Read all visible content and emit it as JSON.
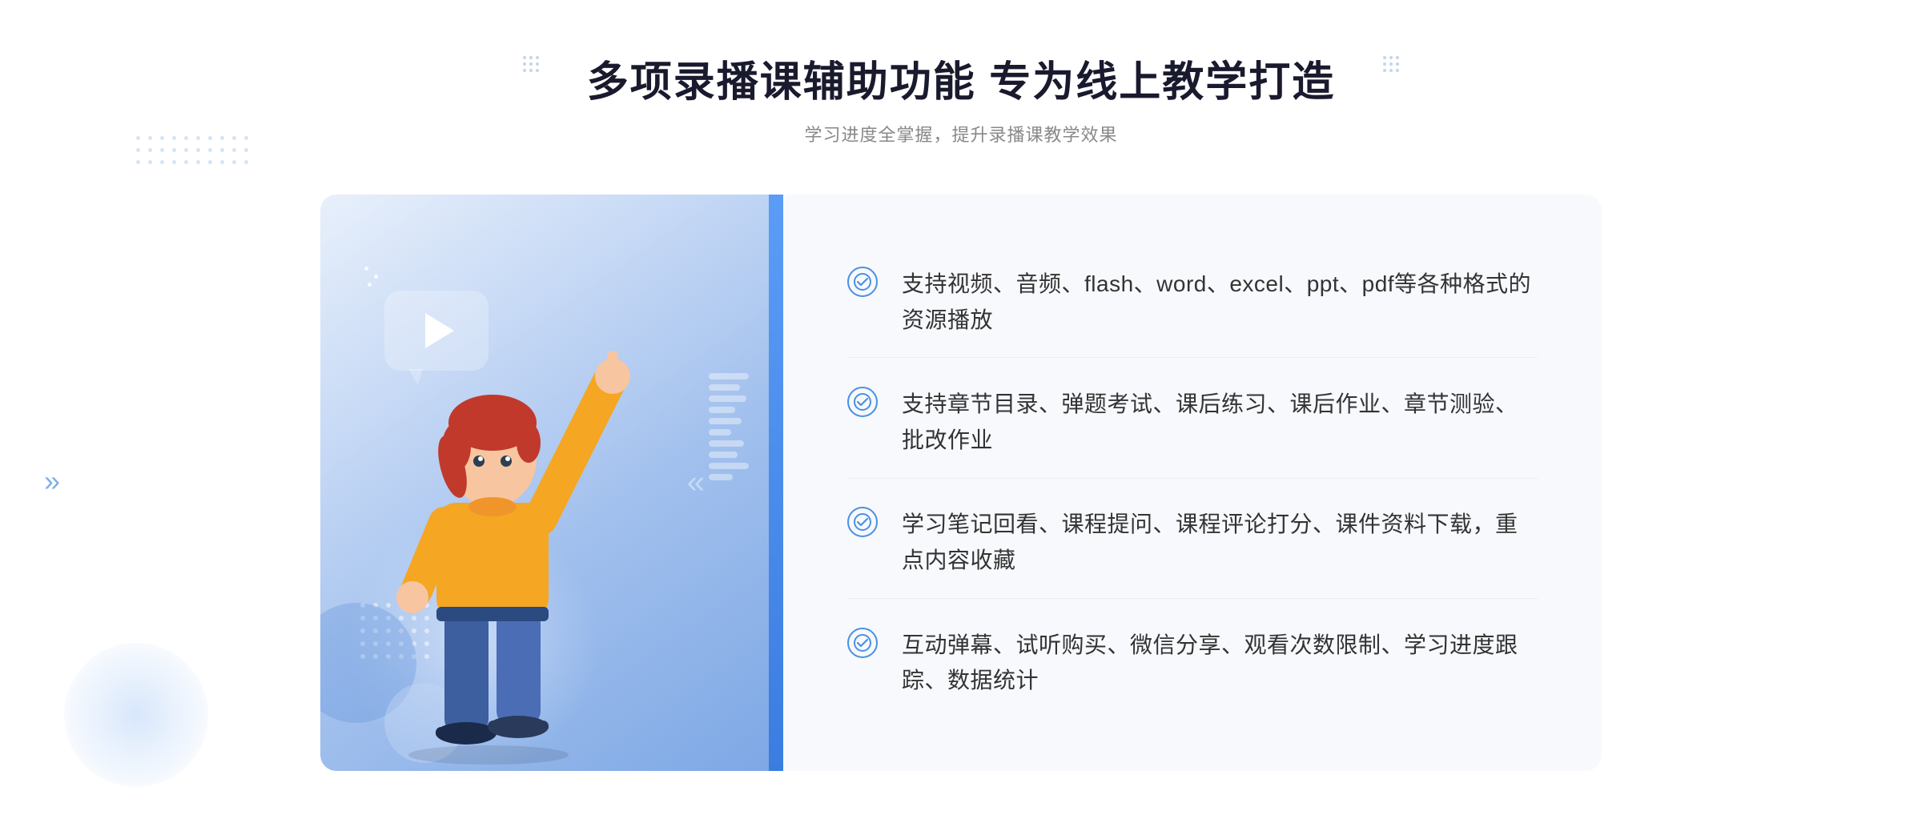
{
  "page": {
    "background": "#ffffff"
  },
  "header": {
    "main_title": "多项录播课辅助功能 专为线上教学打造",
    "sub_title": "学习进度全掌握，提升录播课教学效果"
  },
  "features": [
    {
      "id": 1,
      "text": "支持视频、音频、flash、word、excel、ppt、pdf等各种格式的资源播放"
    },
    {
      "id": 2,
      "text": "支持章节目录、弹题考试、课后练习、课后作业、章节测验、批改作业"
    },
    {
      "id": 3,
      "text": "学习笔记回看、课程提问、课程评论打分、课件资料下载，重点内容收藏"
    },
    {
      "id": 4,
      "text": "互动弹幕、试听购买、微信分享、观看次数限制、学习进度跟踪、数据统计"
    }
  ],
  "icons": {
    "check": "✓",
    "play": "▶",
    "chevron_left": "»",
    "chevron_right": "«"
  }
}
